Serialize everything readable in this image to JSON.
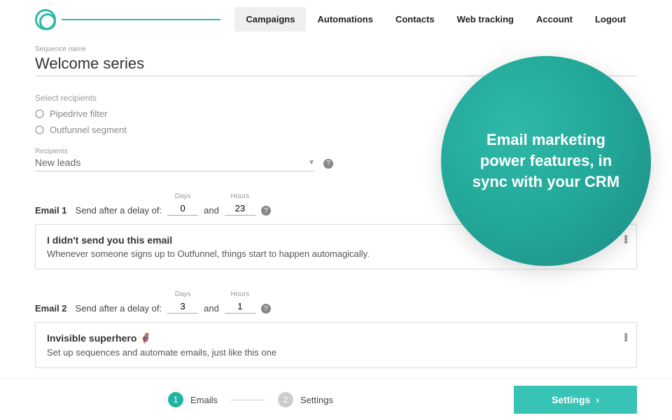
{
  "nav": {
    "items": [
      "Campaigns",
      "Automations",
      "Contacts",
      "Web tracking",
      "Account",
      "Logout"
    ],
    "activeIndex": 0
  },
  "sequence": {
    "label": "Sequence name",
    "name": "Welcome series"
  },
  "recipients": {
    "label": "Select recipients",
    "options": [
      "Pipedrive filter",
      "Outfunnel segment"
    ],
    "fieldLabel": "Recipients",
    "value": "New leads"
  },
  "delayText": {
    "sendAfter": "Send after a delay of:",
    "and": "and",
    "daysCap": "Days",
    "hoursCap": "Hours"
  },
  "emails": [
    {
      "label": "Email 1",
      "days": "0",
      "hours": "23",
      "title": "I didn't send you this email",
      "subtitle": "Whenever someone signs up to Outfunnel, things start to happen automagically."
    },
    {
      "label": "Email 2",
      "days": "3",
      "hours": "1",
      "title": "Invisible superhero 🦸‍♀️",
      "subtitle": "Set up sequences and automate emails, just like this one"
    }
  ],
  "promo": "Email marketing power features, in sync with your CRM",
  "footer": {
    "step1": "Emails",
    "step2": "Settings",
    "cta": "Settings"
  }
}
